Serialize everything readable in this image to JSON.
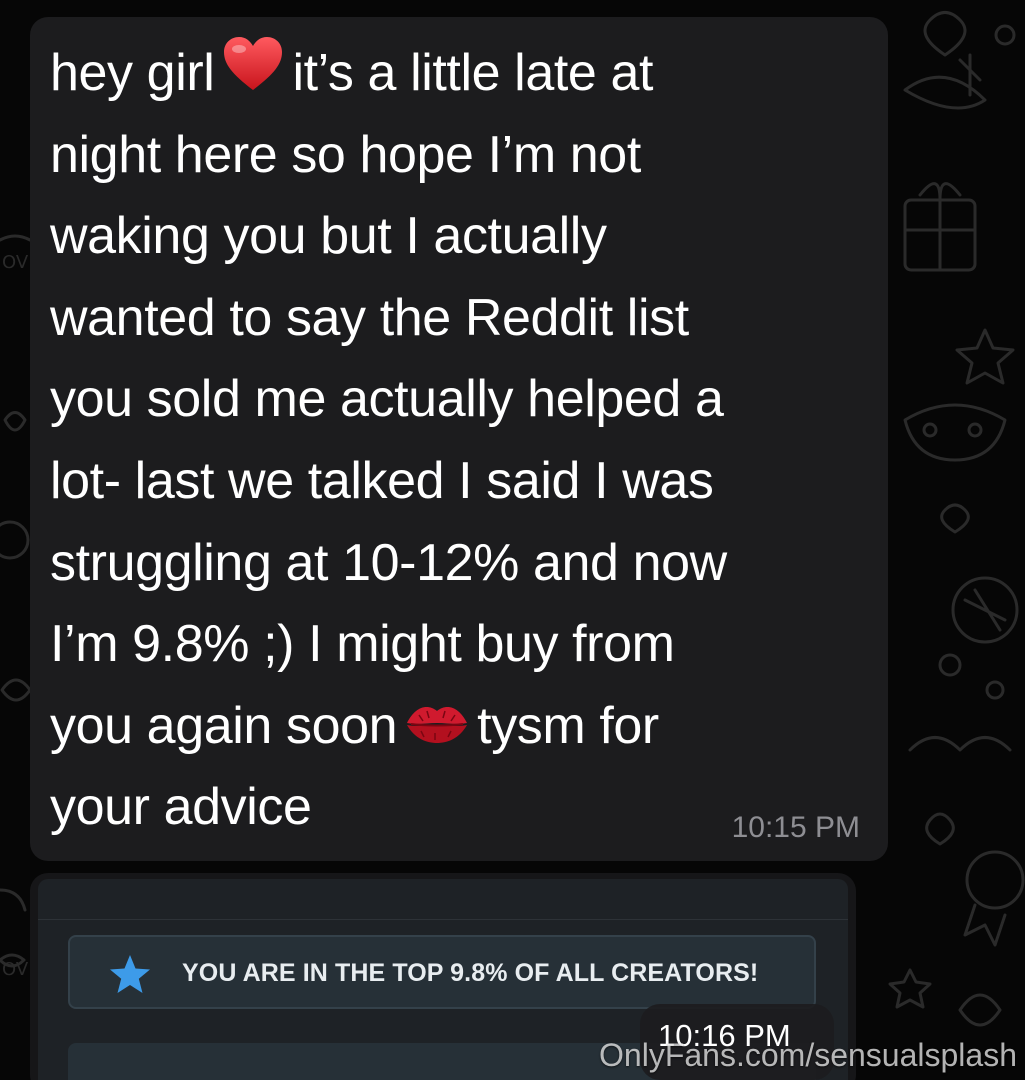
{
  "message": {
    "lines": [
      {
        "before": "hey girl",
        "emoji": "heart",
        "after": "it’s a little late at"
      },
      {
        "text": "night here so hope I’m not"
      },
      {
        "text": "waking you but I actually"
      },
      {
        "text": "wanted to say the Reddit list"
      },
      {
        "text": "you sold me actually helped a"
      },
      {
        "text": "lot- last we talked I said I was"
      },
      {
        "text": "struggling at 10-12% and now"
      },
      {
        "text": "I’m 9.8% ;) I might buy from"
      },
      {
        "before": "you again soon",
        "emoji": "kiss-lips",
        "after": "tysm for"
      },
      {
        "text": "your advice"
      }
    ],
    "time": "10:15 PM"
  },
  "image_message": {
    "banner_icon": "star-icon",
    "banner_text": "YOU ARE IN THE TOP 9.8% OF ALL CREATORS!",
    "time": "10:16 PM"
  },
  "watermark": "OnlyFans.com/sensualsplash",
  "colors": {
    "background": "#060606",
    "bubble": "#1c1c1e",
    "timestamp": "#8e8e93",
    "star": "#3d9be9",
    "heart": "#e3262f",
    "lips": "#c8102e"
  }
}
